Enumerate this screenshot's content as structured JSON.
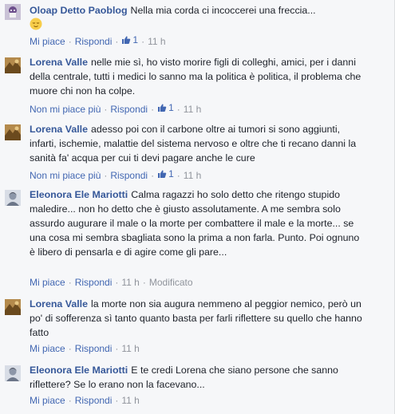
{
  "comments": [
    {
      "author": "Oloap Detto Paoblog",
      "text": "Nella mia corda ci incoccerei una freccia...",
      "emoji": "relieved-face",
      "avatar_icon": "cartoon-avatar-icon",
      "actions": {
        "like": "Mi piace",
        "reply": "Rispondi",
        "likes": "1",
        "time": "11 h"
      }
    },
    {
      "author": "Lorena Valle",
      "text": "nelle mie sì, ho visto morire figli di colleghi, amici, per i danni della centrale, tutti i medici lo sanno ma la politica è politica, il problema che muore chi non ha colpe.",
      "avatar_icon": "photo-avatar-icon",
      "actions": {
        "like": "Non mi piace più",
        "reply": "Rispondi",
        "likes": "1",
        "time": "11 h"
      }
    },
    {
      "author": "Lorena Valle",
      "text": "adesso poi con il carbone oltre ai tumori si sono aggiunti, infarti, ischemie, malattie del sistema nervoso e oltre che ti recano danni la sanità fa' acqua per cui ti devi pagare anche le cure",
      "avatar_icon": "photo-avatar-icon",
      "actions": {
        "like": "Non mi piace più",
        "reply": "Rispondi",
        "likes": "1",
        "time": "11 h"
      }
    },
    {
      "author": "Eleonora Ele Mariotti",
      "text": "Calma ragazzi ho solo detto che ritengo stupido maledire... non ho detto che è giusto assolutamente. A me sembra solo assurdo augurare il male o la morte per combattere il male e la morte... se una cosa mi sembra sbagliata sono la prima a non farla. Punto. Poi ognuno è libero di pensarla e di agire come gli pare...",
      "avatar_icon": "portrait-avatar-icon",
      "actions": {
        "like": "Mi piace",
        "reply": "Rispondi",
        "time": "11 h",
        "edited": "Modificato"
      }
    },
    {
      "author": "Lorena Valle",
      "text": "la morte non sia augura nemmeno al peggior nemico, però un po' di sofferenza sì tanto quanto basta per farli riflettere su quello che hanno fatto",
      "avatar_icon": "photo-avatar-icon",
      "actions": {
        "like": "Mi piace",
        "reply": "Rispondi",
        "time": "11 h"
      }
    },
    {
      "author": "Eleonora Ele Mariotti",
      "text": "E te credi Lorena che siano persone che sanno riflettere? Se lo erano non la facevano...",
      "avatar_icon": "portrait-avatar-icon",
      "actions": {
        "like": "Mi piace",
        "reply": "Rispondi",
        "time": "11 h"
      }
    }
  ],
  "colors": {
    "author": "#365899",
    "link": "#4267b2",
    "meta": "#90949c",
    "text": "#1d2129",
    "background": "#f6f7f9"
  }
}
